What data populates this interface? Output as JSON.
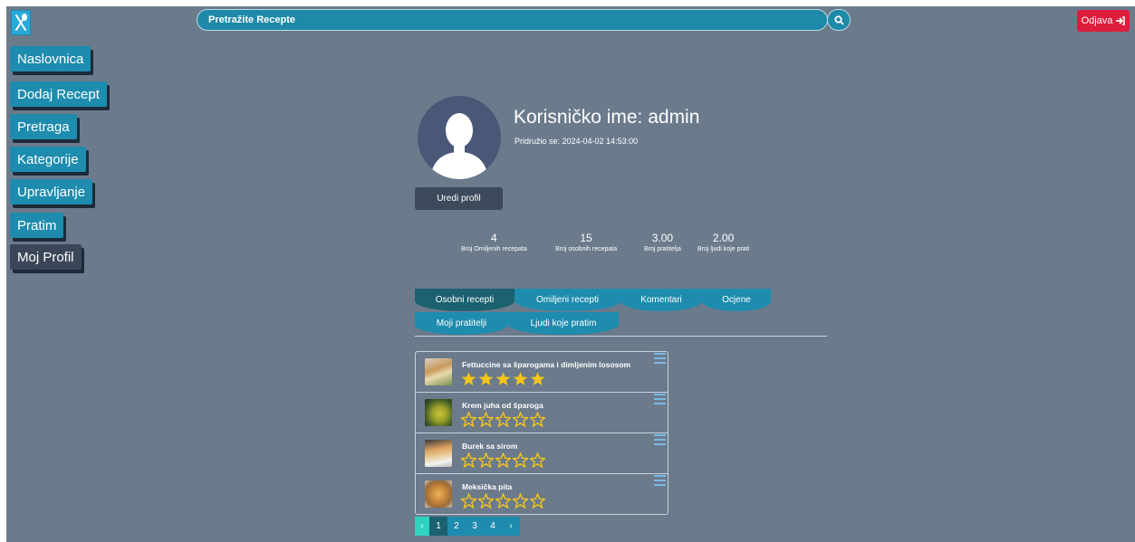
{
  "header": {
    "search_placeholder": "Pretražite Recepte",
    "logout_label": "Odjava"
  },
  "sidebar": {
    "items": [
      {
        "label": "Naslovnica"
      },
      {
        "label": "Dodaj Recept"
      },
      {
        "label": "Pretraga"
      },
      {
        "label": "Kategorije"
      },
      {
        "label": "Upravljanje"
      },
      {
        "label": "Pratim"
      },
      {
        "label": "Moj Profil"
      }
    ]
  },
  "profile": {
    "username": "Korisničko ime: admin",
    "joined": "Pridružio se: 2024-04-02 14:53:00",
    "edit_label": "Uredi profil"
  },
  "stats": [
    {
      "value": "4",
      "label": "Broj Omiljenih recepata"
    },
    {
      "value": "15",
      "label": "Broj osobnih recepata"
    },
    {
      "value": "3.00",
      "label": "Broj pratitelja"
    },
    {
      "value": "2.00",
      "label": "Broj ljudi koje prati"
    }
  ],
  "tabs": [
    {
      "label": "Osobni recepti"
    },
    {
      "label": "Omiljeni recepti"
    },
    {
      "label": "Komentari"
    },
    {
      "label": "Ocjene"
    },
    {
      "label": "Moji pratitelji"
    },
    {
      "label": "Ljudi koje pratim"
    }
  ],
  "recipes": [
    {
      "title": "Fettuccine sa šparogama i dimljenim lososom",
      "rating": 5
    },
    {
      "title": "Krem juha od šparoga",
      "rating": 0
    },
    {
      "title": "Burek sa sirom",
      "rating": 0
    },
    {
      "title": "Meksička pita",
      "rating": 0
    }
  ],
  "pagination": {
    "prev": "‹",
    "pages": [
      "1",
      "2",
      "3",
      "4"
    ],
    "next": "›",
    "current": "1"
  },
  "colors": {
    "background": "#6b7b8c",
    "accent": "#1e8cae",
    "logout": "#dc1e3c",
    "star": "#f5c518"
  }
}
